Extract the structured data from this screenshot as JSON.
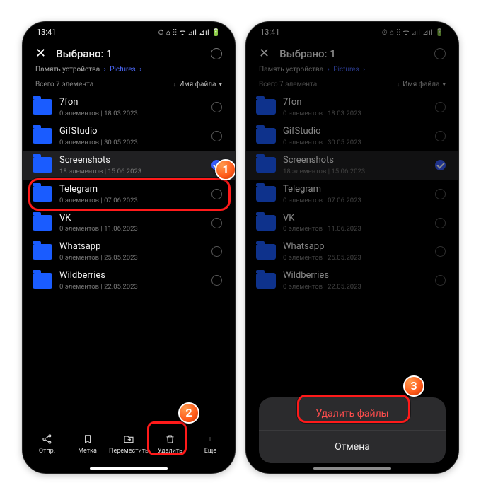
{
  "statusbar": {
    "time": "13:41",
    "indicators": "⏱ ⌂ ⋮⋮ ᯤ ⊿ıl ⊿ıl 🔋"
  },
  "header": {
    "title": "Выбрано: 1"
  },
  "breadcrumb": {
    "root": "Память устройства",
    "current": "Pictures"
  },
  "listhead": {
    "count": "Всего 7 элемента",
    "sort": "Имя файла"
  },
  "folders": [
    {
      "name": "7fon",
      "sub": "0 элементов | 18.03.2023",
      "selected": false
    },
    {
      "name": "GifStudio",
      "sub": "0 элементов | 30.05.2023",
      "selected": false
    },
    {
      "name": "Screenshots",
      "sub": "18 элементов | 15.06.2023",
      "selected": true
    },
    {
      "name": "Telegram",
      "sub": "0 элементов | 07.06.2023",
      "selected": false
    },
    {
      "name": "VK",
      "sub": "0 элементов | 11.06.2023",
      "selected": false
    },
    {
      "name": "Whatsapp",
      "sub": "0 элементов | 25.05.2023",
      "selected": false
    },
    {
      "name": "Wildberries",
      "sub": "0 элементов | 22.05.2023",
      "selected": false
    }
  ],
  "bottombar": {
    "send": "Отпр.",
    "tag": "Метка",
    "move": "Переместить",
    "delete": "Удалить",
    "more": "Еще"
  },
  "dialog": {
    "delete": "Удалить файлы",
    "cancel": "Отмена"
  }
}
